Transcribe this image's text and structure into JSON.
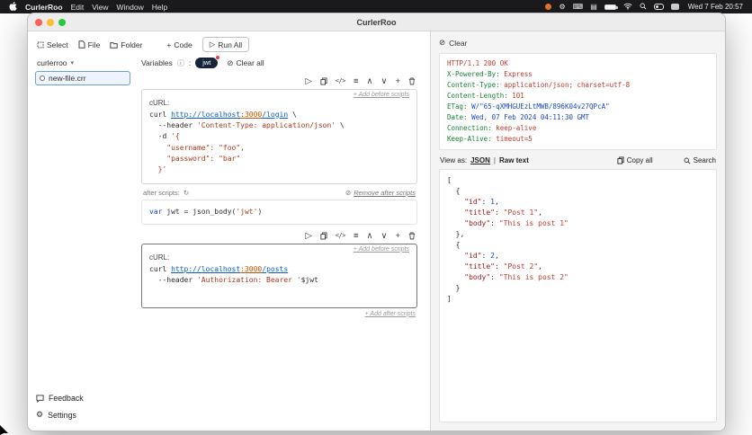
{
  "menu_bar": {
    "app_name": "CurlerRoo",
    "items": [
      "Edit",
      "View",
      "Window",
      "Help"
    ],
    "clock": "Wed 7 Feb 20:57"
  },
  "window_title": "CurlerRoo",
  "toolbar": {
    "select_label": "Select",
    "file_label": "File",
    "folder_label": "Folder",
    "code_label": "Code",
    "run_all_label": "Run All"
  },
  "sidebar": {
    "folder_name": "curlerroo",
    "file_name": "new-file.crr",
    "feedback_label": "Feedback",
    "settings_label": "Settings"
  },
  "variables": {
    "label": "Variables",
    "colon": ":",
    "chip": "jwt",
    "clear_all_label": "Clear all"
  },
  "icons": {
    "play": "▷",
    "code": "</>",
    "format": "≡",
    "up": "∧",
    "down": "∨",
    "add": "+",
    "info": "ⓘ",
    "clear": "⊘",
    "refresh": "↻",
    "chevron_down": "▾",
    "gear": "⚙",
    "keyboard": "⌨",
    "display": "▤"
  },
  "blocks": [
    {
      "curl_label": "cURL:",
      "add_before_label": "+ Add before scripts",
      "curl_lines": [
        [
          {
            "t": "plain",
            "v": "curl "
          },
          {
            "t": "url",
            "v": "http://localhost"
          },
          {
            "t": "port",
            "v": ":3000"
          },
          {
            "t": "url",
            "v": "/login"
          },
          {
            "t": "plain",
            "v": " \\"
          }
        ],
        [
          {
            "t": "plain",
            "v": "  --header "
          },
          {
            "t": "string",
            "v": "'Content-Type: application/json'"
          },
          {
            "t": "plain",
            "v": " \\"
          }
        ],
        [
          {
            "t": "plain",
            "v": "  -d "
          },
          {
            "t": "string",
            "v": "'{"
          }
        ],
        [
          {
            "t": "string",
            "v": "    \"username\": \"foo\","
          }
        ],
        [
          {
            "t": "string",
            "v": "    \"password\": \"bar\""
          }
        ],
        [
          {
            "t": "string",
            "v": "  }'"
          }
        ]
      ],
      "after_scripts_label": "after scripts:",
      "remove_after_label": "Remove after scripts",
      "script_lines": [
        [
          {
            "t": "keyword",
            "v": "var"
          },
          {
            "t": "plain",
            "v": " jwt = json_body("
          },
          {
            "t": "string",
            "v": "'jwt'"
          },
          {
            "t": "plain",
            "v": ")"
          }
        ]
      ]
    },
    {
      "curl_label": "cURL:",
      "add_before_label": "+ Add before scripts",
      "add_after_label": "+ Add after scripts",
      "curl_lines": [
        [
          {
            "t": "plain",
            "v": "curl "
          },
          {
            "t": "url",
            "v": "http://localhost"
          },
          {
            "t": "port",
            "v": ":3000"
          },
          {
            "t": "url",
            "v": "/posts"
          }
        ],
        [
          {
            "t": "plain",
            "v": "  --header "
          },
          {
            "t": "string",
            "v": "'Authorization: Bearer '"
          },
          {
            "t": "plain",
            "v": "$jwt"
          }
        ]
      ]
    }
  ],
  "response": {
    "clear_label": "Clear",
    "headers": [
      {
        "value": "HTTP/1.1 200 OK",
        "color": "#c0392b"
      },
      {
        "key": "X-Powered-By",
        "value": "Express"
      },
      {
        "key": "Content-Type",
        "value": "application/json; charset=utf-8"
      },
      {
        "key": "Content-Length",
        "value": "101"
      },
      {
        "key": "ETag",
        "value": "W/\"65-qXMHGUEzLtMWB/896K04v27QPcA\"",
        "color": "#1948c8"
      },
      {
        "key": "Date",
        "value": "Wed, 07 Feb 2024 04:11:30 GMT",
        "color": "#1948c8"
      },
      {
        "key": "Connection",
        "value": "keep-alive"
      },
      {
        "key": "Keep-Alive",
        "value": "timeout=5"
      }
    ],
    "view_as_label": "View as:",
    "json_tab": "JSON",
    "separator": "|",
    "raw_tab": "Raw text",
    "copy_all_label": "Copy all",
    "search_label": "Search",
    "body_lines": [
      [
        {
          "t": "plain",
          "v": "["
        }
      ],
      [
        {
          "t": "plain",
          "v": "  {"
        }
      ],
      [
        {
          "t": "key",
          "v": "    \"id\""
        },
        {
          "t": "plain",
          "v": ": "
        },
        {
          "t": "num",
          "v": "1"
        },
        {
          "t": "plain",
          "v": ","
        }
      ],
      [
        {
          "t": "key",
          "v": "    \"title\""
        },
        {
          "t": "plain",
          "v": ": "
        },
        {
          "t": "str",
          "v": "\"Post 1\""
        },
        {
          "t": "plain",
          "v": ","
        }
      ],
      [
        {
          "t": "key",
          "v": "    \"body\""
        },
        {
          "t": "plain",
          "v": ": "
        },
        {
          "t": "str",
          "v": "\"This is post 1\""
        }
      ],
      [
        {
          "t": "plain",
          "v": "  },"
        }
      ],
      [
        {
          "t": "plain",
          "v": "  {"
        }
      ],
      [
        {
          "t": "key",
          "v": "    \"id\""
        },
        {
          "t": "plain",
          "v": ": "
        },
        {
          "t": "num",
          "v": "2"
        },
        {
          "t": "plain",
          "v": ","
        }
      ],
      [
        {
          "t": "key",
          "v": "    \"title\""
        },
        {
          "t": "plain",
          "v": ": "
        },
        {
          "t": "str",
          "v": "\"Post 2\""
        },
        {
          "t": "plain",
          "v": ","
        }
      ],
      [
        {
          "t": "key",
          "v": "    \"body\""
        },
        {
          "t": "plain",
          "v": ": "
        },
        {
          "t": "str",
          "v": "\"This is post 2\""
        }
      ],
      [
        {
          "t": "plain",
          "v": "  }"
        }
      ],
      [
        {
          "t": "plain",
          "v": "]"
        }
      ]
    ]
  }
}
